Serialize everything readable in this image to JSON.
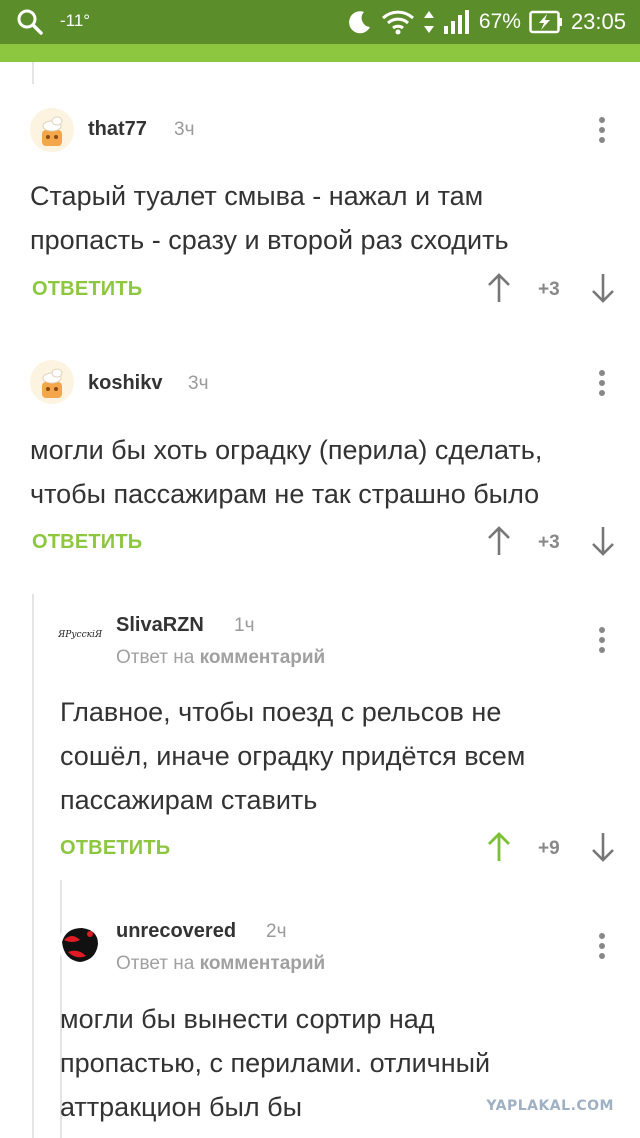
{
  "status_bar": {
    "temperature": "-11°",
    "battery": "67%",
    "time": "23:05"
  },
  "comments": [
    {
      "username": "that77",
      "time": "3ч",
      "lines": [
        "Старый туалет смыва - нажал и там",
        "пропасть - сразу и второй раз сходить"
      ],
      "reply_label": "ОТВЕТИТЬ",
      "score": "+3"
    },
    {
      "username": "koshikv",
      "time": "3ч",
      "lines": [
        "могли бы хоть оградку (перила) сделать,",
        "чтобы пассажирам не так страшно было"
      ],
      "reply_label": "ОТВЕТИТЬ",
      "score": "+3"
    },
    {
      "username": "SlivaRZN",
      "avatar_text": "ЯРусскiЯ",
      "time": "1ч",
      "reply_prefix": "Ответ на",
      "reply_target": "комментарий",
      "lines": [
        "Главное, чтобы поезд с рельсов не",
        "сошёл, иначе оградку придётся всем",
        "пассажирам ставить"
      ],
      "reply_label": "ОТВЕТИТЬ",
      "score": "+9"
    },
    {
      "username": "unrecovered",
      "time": "2ч",
      "reply_prefix": "Ответ на",
      "reply_target": "комментарий",
      "lines": [
        "могли бы вынести сортир над",
        "пропастью, с перилами. отличный",
        "аттракцион был бы"
      ]
    }
  ],
  "watermark": "YAPLAKAL.COM",
  "colors": {
    "status_bar": "#5b8e2b",
    "accent": "#8dc63f",
    "upvoted": "#7cc036"
  }
}
